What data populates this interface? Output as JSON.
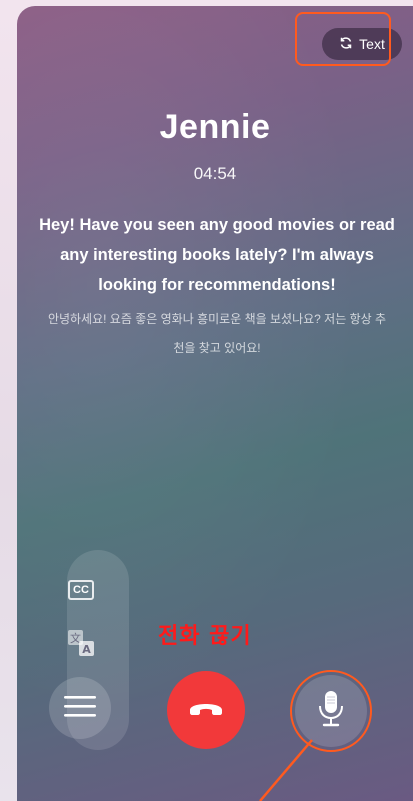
{
  "header": {
    "text_toggle_label": "Text",
    "text_toggle_icon": "refresh-icon"
  },
  "call": {
    "caller_name": "Jennie",
    "timer": "04:54",
    "transcript_en": "Hey! Have you seen any good movies or read any interesting books lately? I'm always looking for recommendations!",
    "transcript_ko": "안녕하세요! 요즘 좋은 영화나 흥미로운 책을 보셨나요? 저는 항상 추천을 찾고 있어요!"
  },
  "controls": {
    "cc_label": "CC",
    "translate_icon": "translate-icon",
    "menu_icon": "hamburger-menu-icon",
    "hangup_icon": "phone-hangup-icon",
    "mic_icon": "microphone-icon"
  },
  "annotations": {
    "hangup_label": "전화 끊기",
    "highlight_color": "#ff5a1f",
    "hangup_label_color": "#ff1a1a"
  },
  "colors": {
    "hangup_button": "#f2393a",
    "text_primary": "#ffffff"
  }
}
